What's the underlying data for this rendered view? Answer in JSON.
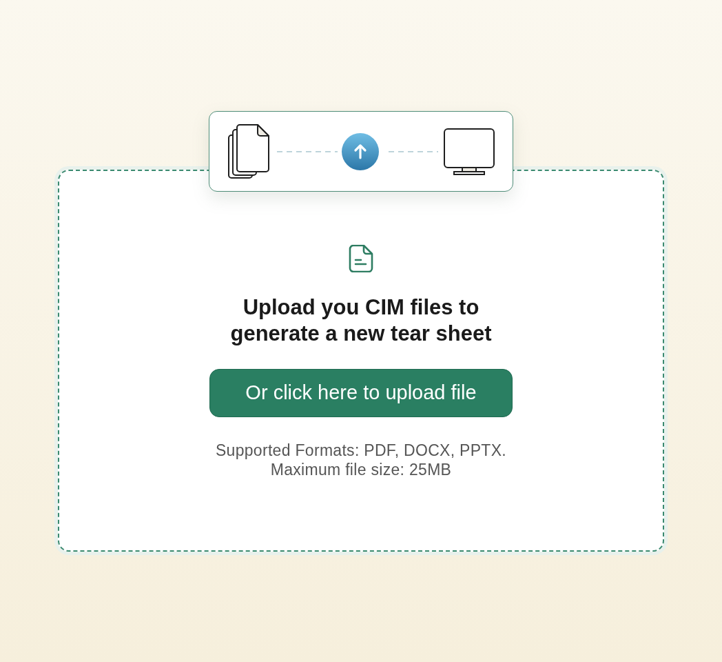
{
  "dropzone": {
    "title": "Upload you CIM files to generate a new tear sheet",
    "button": {
      "label": "Or click here to upload file"
    },
    "hints": [
      "Supported Formats: PDF, DOCX, PPTX.",
      "Maximum file size: 25MB"
    ]
  }
}
